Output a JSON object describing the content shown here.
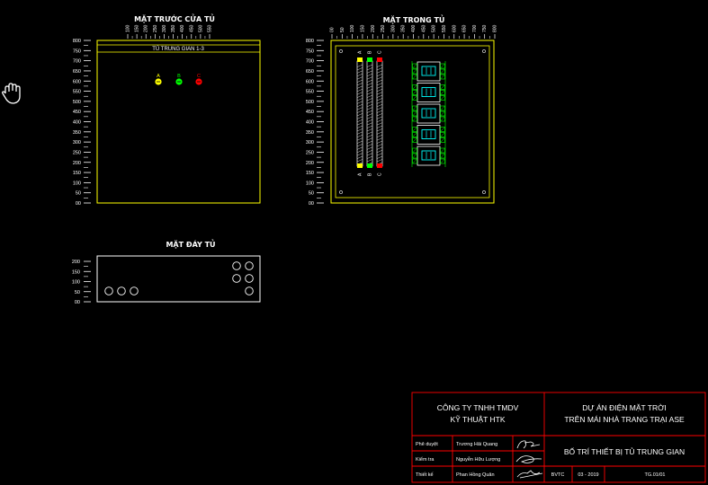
{
  "views": {
    "front": {
      "title": "MẶT TRƯỚC CỬA TỦ",
      "panel_label": "TỦ TRUNG GIAN 1-3"
    },
    "inside": {
      "title": "MẶT TRONG TỦ"
    },
    "bottom": {
      "title": "MẶT ĐÁY TỦ"
    }
  },
  "vertical_scale": [
    "800",
    "750",
    "700",
    "650",
    "600",
    "550",
    "500",
    "450",
    "400",
    "350",
    "300",
    "250",
    "200",
    "150",
    "100",
    "50",
    "00"
  ],
  "bottom_scale": [
    "200",
    "150",
    "100",
    "50",
    "00"
  ],
  "front_top_scale": [
    "100",
    "150",
    "200",
    "250",
    "300",
    "350",
    "400",
    "450",
    "500",
    "550"
  ],
  "inside_top_scale": [
    "00",
    "50",
    "100",
    "150",
    "200",
    "250",
    "300",
    "350",
    "400",
    "450",
    "500",
    "550",
    "600",
    "650",
    "700",
    "750",
    "800"
  ],
  "indicators": [
    {
      "label": "A",
      "color": "#ffff00"
    },
    {
      "label": "B",
      "color": "#00ff00"
    },
    {
      "label": "C",
      "color": "#ff0000"
    }
  ],
  "busbar_labels": [
    "A",
    "B",
    "C"
  ],
  "title_block": {
    "company_line1": "CÔNG TY TNHH TMDV",
    "company_line2": "KỸ THUẬT HTK",
    "project_line1": "DỰ ÁN ĐIỆN MẶT TRỜI",
    "project_line2": "TRÊN MÁI NHÀ TRANG TRẠI ASE",
    "drawing_title": "BỐ TRÍ THIẾT BỊ TỦ TRUNG GIAN",
    "rows": [
      {
        "role": "Phê duyệt",
        "name": "Trương Hải Quang"
      },
      {
        "role": "Kiểm tra",
        "name": "Nguyễn Hữu Lượng"
      },
      {
        "role": "Thiết kế",
        "name": "Phan Hồng Quân"
      }
    ],
    "stage": "BVTC",
    "date": "03 - 2019",
    "drawing_no": "TG.01/01"
  },
  "colors": {
    "frame": "#ffff00",
    "accent_cyan": "#00ffff",
    "terminal_green": "#00ff00",
    "title_block_red": "#ff0000",
    "text": "#ffffff"
  },
  "cursor_icon": "hand-pan-icon"
}
